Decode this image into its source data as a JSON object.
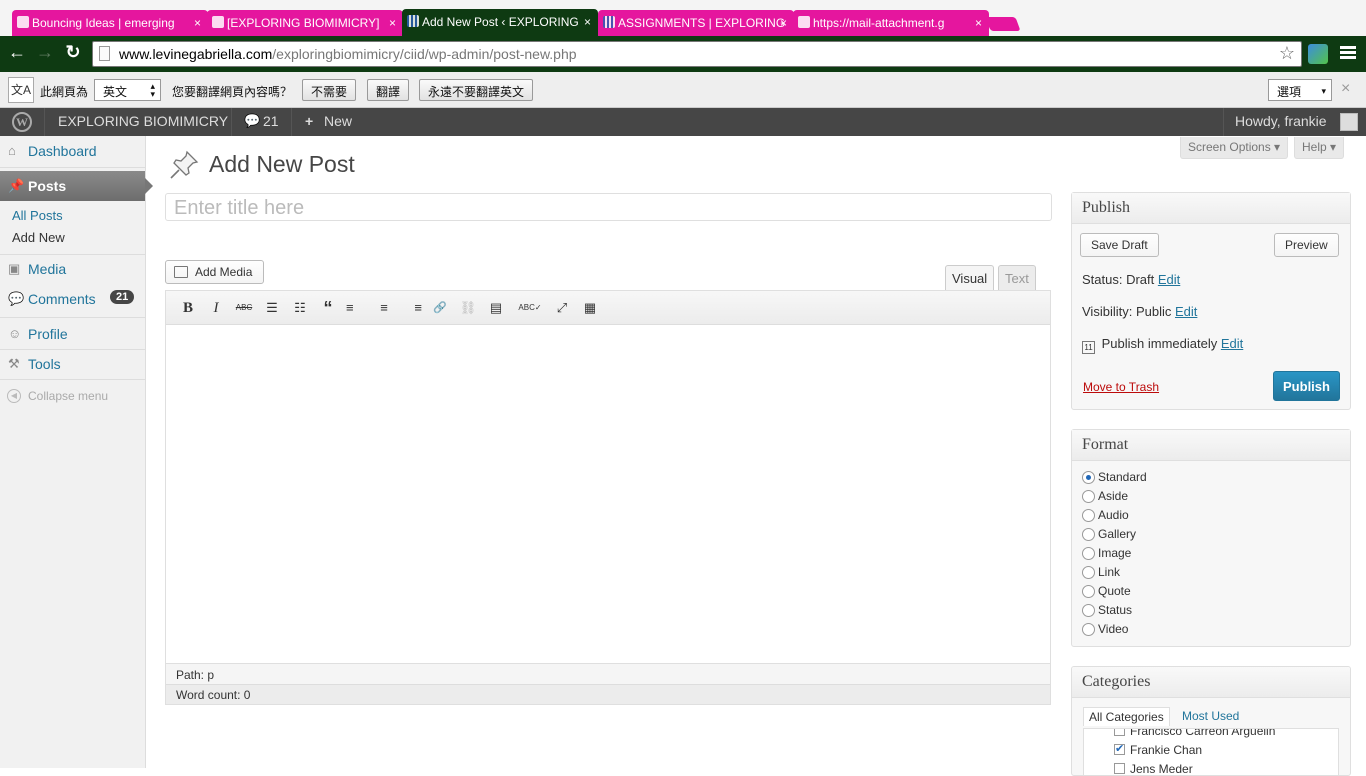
{
  "browser": {
    "tabs": [
      {
        "title": "Bouncing Ideas | emerging",
        "active": false
      },
      {
        "title": "[EXPLORING BIOMIMICRY] ",
        "active": false
      },
      {
        "title": "Add New Post ‹ EXPLORING",
        "active": true
      },
      {
        "title": "ASSIGNMENTS | EXPLORING",
        "active": false
      },
      {
        "title": "https://mail-attachment.g",
        "active": false
      }
    ],
    "tab_close": "×",
    "back_icon": "←",
    "forward_icon": "→",
    "reload_icon": "↻",
    "url_host": "www.levinegabriella.com",
    "url_path": "/exploringbiomimicry/ciid/wp-admin/post-new.php",
    "star_icon": "☆"
  },
  "translate_bar": {
    "icon": "文A",
    "prefix": "此網頁為",
    "language": "英文",
    "question": "您要翻譯網頁內容嗎？",
    "no_button": "不需要",
    "translate_button": "翻譯",
    "never_button": "永遠不要翻譯英文",
    "options": "選項",
    "close": "×"
  },
  "admin_bar": {
    "site_name": "EXPLORING BIOMIMICRY",
    "comments_count": "21",
    "new_label": "New",
    "howdy": "Howdy, frankie"
  },
  "sidebar": {
    "dashboard": "Dashboard",
    "posts": "Posts",
    "all_posts": "All Posts",
    "add_new": "Add New",
    "media": "Media",
    "comments": "Comments",
    "comments_badge": "21",
    "profile": "Profile",
    "tools": "Tools",
    "collapse": "Collapse menu"
  },
  "screen_options": "Screen Options ▾",
  "help": "Help ▾",
  "page_title": "Add New Post",
  "title_placeholder": "Enter title here",
  "add_media": "Add Media",
  "editor_tabs": {
    "visual": "Visual",
    "text": "Text"
  },
  "toolbar": {
    "bold": "B",
    "italic": "I",
    "strike": "ABC",
    "bullets": "☰",
    "numbered": "☷",
    "quote": "“",
    "align_left": "≡",
    "align_center": "≡",
    "align_right": "≡",
    "link": "🔗",
    "unlink": "⛓",
    "more": "▤",
    "spell": "ABC✓",
    "fullscreen": "⤢",
    "kitchen": "▦"
  },
  "path": "Path: p",
  "word_count": "Word count: 0",
  "publish_box": {
    "title": "Publish",
    "save_draft": "Save Draft",
    "preview": "Preview",
    "status_label": "Status: Draft",
    "visibility_label": "Visibility: Public",
    "schedule_label": "Publish immediately",
    "edit": "Edit",
    "move_to_trash": "Move to Trash",
    "publish": "Publish"
  },
  "format_box": {
    "title": "Format",
    "options": [
      "Standard",
      "Aside",
      "Audio",
      "Gallery",
      "Image",
      "Link",
      "Quote",
      "Status",
      "Video"
    ],
    "selected": "Standard"
  },
  "categories_box": {
    "title": "Categories",
    "tab_all": "All Categories",
    "tab_used": "Most Used",
    "items": [
      {
        "name": "Francisco Carreon Arguelin",
        "checked": false
      },
      {
        "name": "Frankie Chan",
        "checked": true
      },
      {
        "name": "Jens Meder",
        "checked": false
      }
    ]
  }
}
